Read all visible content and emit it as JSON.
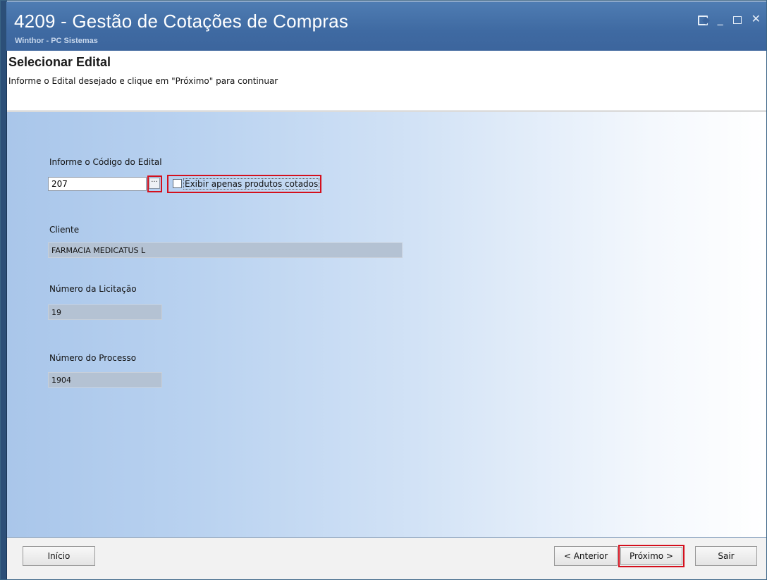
{
  "window": {
    "title": "4209 - Gestão de Cotações de Compras",
    "subtitle": "Winthor - PC Sistemas",
    "controls": [
      "restore-icon",
      "minimize-icon",
      "maximize-icon",
      "close-icon"
    ]
  },
  "header": {
    "title": "Selecionar Edital",
    "description": "Informe o Edital desejado e clique em \"Próximo\" para continuar"
  },
  "form": {
    "edital_label": "Informe o Código do Edital",
    "edital_value": "207",
    "lookup_label": "···",
    "checkbox_label": "Exibir apenas produtos cotados",
    "checkbox_checked": false,
    "cliente_label": "Cliente",
    "cliente_value": "FARMACIA MEDICATUS L",
    "licitacao_label": "Número da Licitação",
    "licitacao_value": "19",
    "processo_label": "Número do Processo",
    "processo_value": "1904"
  },
  "footer": {
    "inicio": "Início",
    "anterior": "< Anterior",
    "proximo": "Próximo >",
    "sair": "Sair"
  },
  "colors": {
    "titlebar": "#3f6aa2",
    "highlight": "#d4101d",
    "gradient_start": "#a9c6ea"
  }
}
